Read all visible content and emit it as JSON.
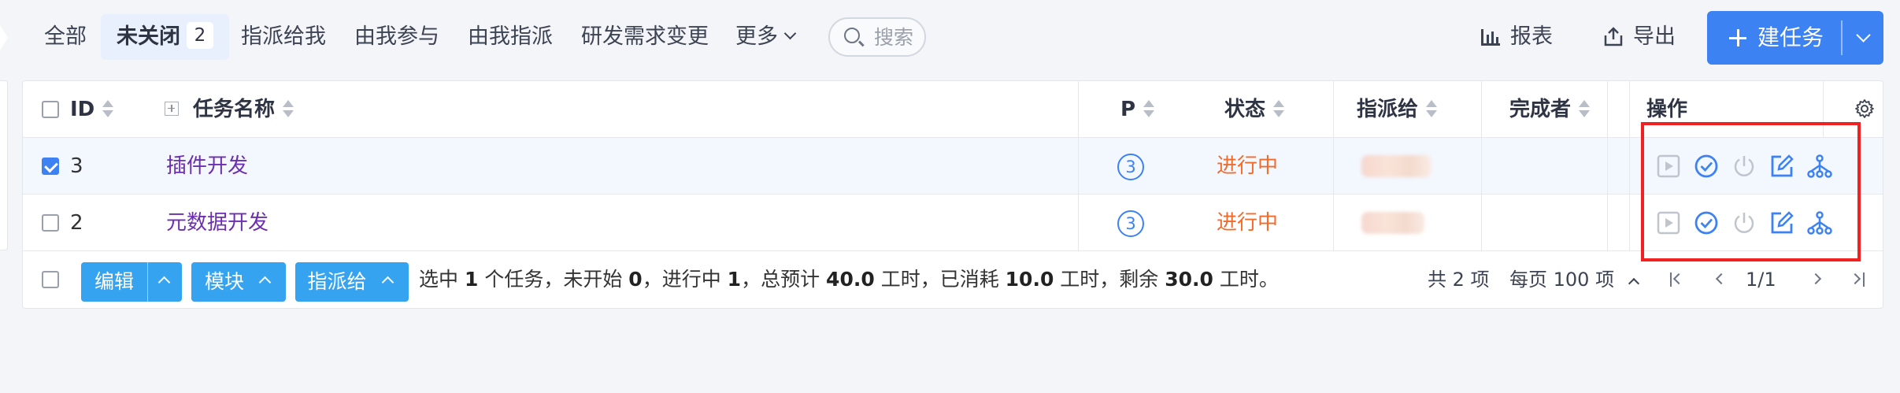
{
  "tabs": [
    {
      "label": "全部"
    },
    {
      "label": "未关闭",
      "badge": "2"
    },
    {
      "label": "指派给我"
    },
    {
      "label": "由我参与"
    },
    {
      "label": "由我指派"
    },
    {
      "label": "研发需求变更"
    },
    {
      "label": "更多"
    }
  ],
  "search": {
    "placeholder": "搜索"
  },
  "toolbar": {
    "report_label": "报表",
    "export_label": "导出",
    "create_label": "建任务"
  },
  "table": {
    "headers": {
      "id": "ID",
      "name": "任务名称",
      "priority": "P",
      "status": "状态",
      "assigned": "指派给",
      "finished_by": "完成者",
      "actions": "操作"
    },
    "rows": [
      {
        "id": "3",
        "name": "插件开发",
        "priority": "3",
        "status": "进行中",
        "selected": true
      },
      {
        "id": "2",
        "name": "元数据开发",
        "priority": "3",
        "status": "进行中",
        "selected": false
      }
    ],
    "action_icons": [
      "start-icon",
      "finish-icon",
      "close-icon",
      "edit-icon",
      "subtask-icon"
    ]
  },
  "footer": {
    "batch_edit_label": "编辑",
    "module_label": "模块",
    "assign_label": "指派给",
    "summary": {
      "t1": "选中",
      "selected": "1",
      "t2": "个任务，未开始",
      "not_started": "0",
      "t3": "，进行中",
      "in_progress": "1",
      "t4": "，总预计",
      "estimate": "40.0",
      "t5": "工时，已消耗",
      "consumed": "10.0",
      "t6": "工时，剩余",
      "left": "30.0",
      "t7": "工时。"
    },
    "pager": {
      "total_text": "共 2 项",
      "per_page_text": "每页 100 项",
      "page_text": "1/1"
    }
  },
  "colors": {
    "accent": "#3d82f3",
    "status_doing": "#f26b2a",
    "task_link": "#6b2fb0",
    "highlight_box": "#f22121",
    "batch_button": "#35a3f0"
  }
}
